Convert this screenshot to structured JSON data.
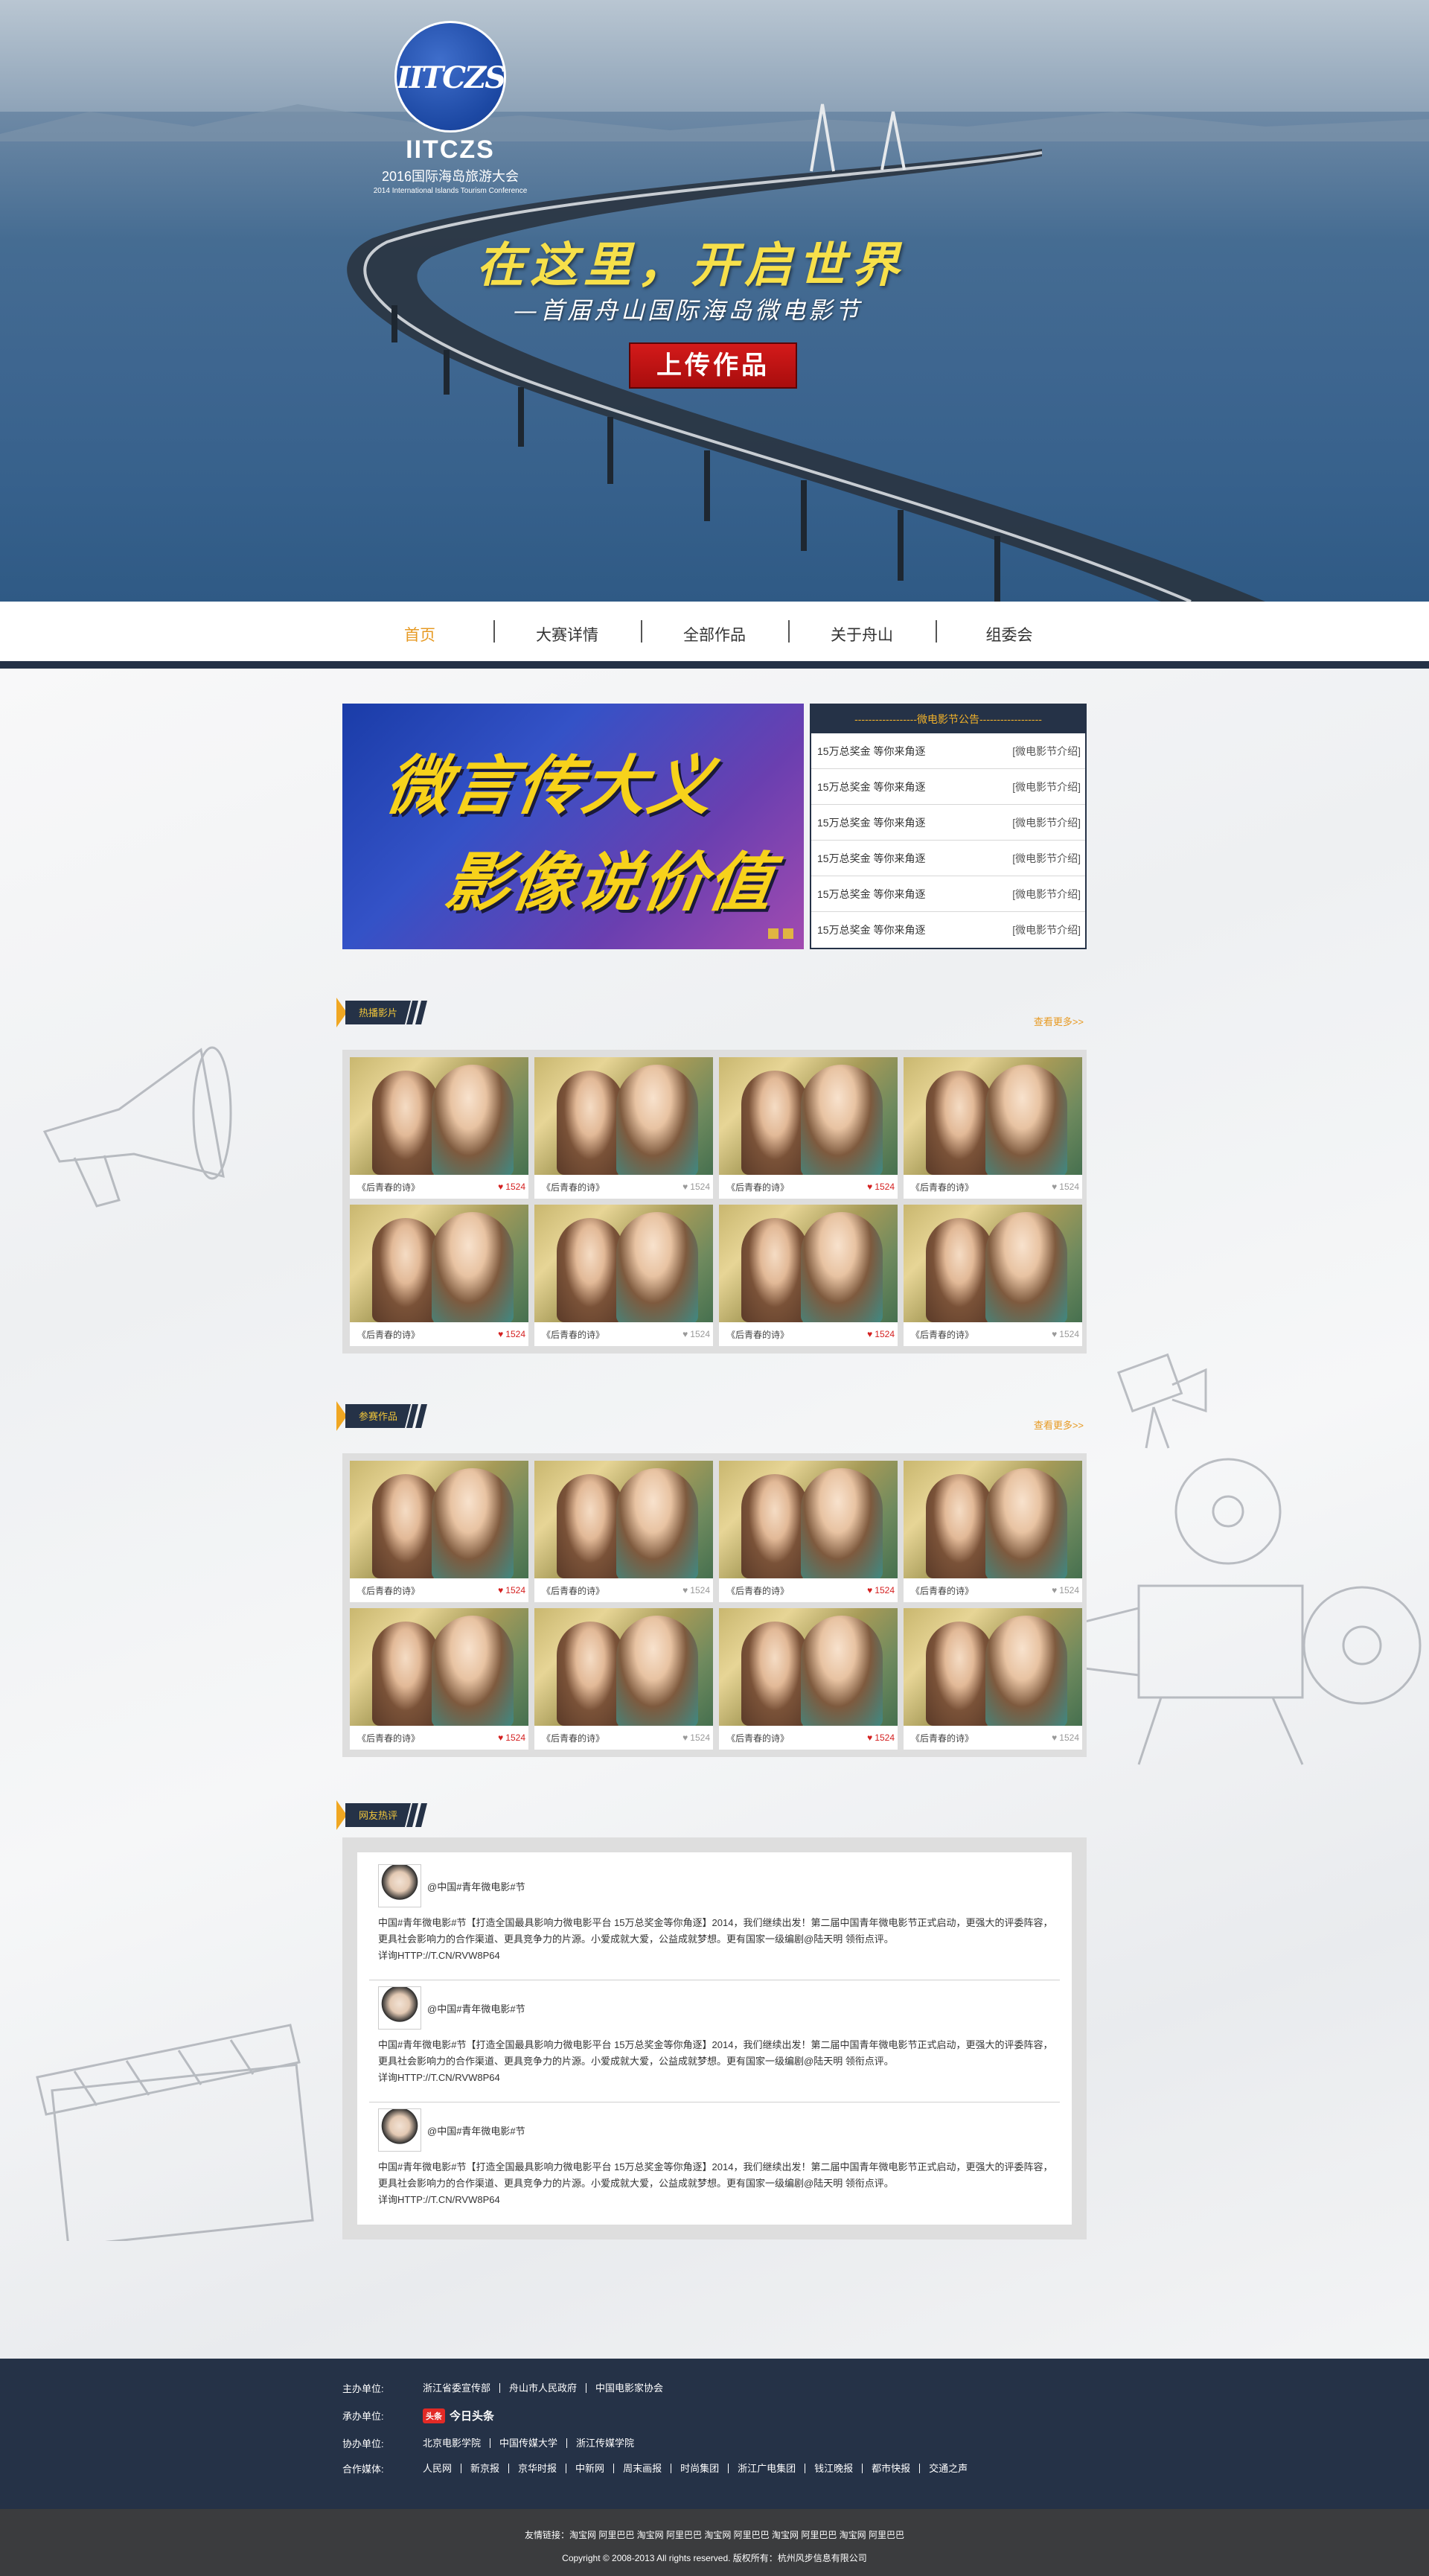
{
  "hero": {
    "logo_letters": "IITCZS",
    "brand": "IITCZS",
    "conference_cn": "2016国际海岛旅游大会",
    "conference_en": "2014 International Islands Tourism Conference",
    "slogan": "在这里，开启世界",
    "subslogan": "—首届舟山国际海岛微电影节",
    "upload_button": "上传作品"
  },
  "nav": {
    "items": [
      {
        "label": "首页",
        "active": true
      },
      {
        "label": "大赛详情",
        "active": false
      },
      {
        "label": "全部作品",
        "active": false
      },
      {
        "label": "关于舟山",
        "active": false
      },
      {
        "label": "组委会",
        "active": false
      }
    ]
  },
  "banner": {
    "line1": "微言传大义",
    "line2": "影像说价值"
  },
  "notice": {
    "title": "------------------微电影节公告------------------",
    "items": [
      {
        "text": "15万总奖金 等你来角逐",
        "tag": "[微电影节介绍]"
      },
      {
        "text": "15万总奖金 等你来角逐",
        "tag": "[微电影节介绍]"
      },
      {
        "text": "15万总奖金 等你来角逐",
        "tag": "[微电影节介绍]"
      },
      {
        "text": "15万总奖金 等你来角逐",
        "tag": "[微电影节介绍]"
      },
      {
        "text": "15万总奖金 等你来角逐",
        "tag": "[微电影节介绍]"
      },
      {
        "text": "15万总奖金 等你来角逐",
        "tag": "[微电影节介绍]"
      }
    ]
  },
  "sections": {
    "hot": {
      "label": "热播影片",
      "more": "查看更多>>"
    },
    "entries": {
      "label": "参赛作品",
      "more": "查看更多>>"
    },
    "comments": {
      "label": "网友热评"
    }
  },
  "hot_cards": [
    {
      "title": "《后青春的诗》",
      "likes": "1524",
      "liked": true
    },
    {
      "title": "《后青春的诗》",
      "likes": "1524",
      "liked": false
    },
    {
      "title": "《后青春的诗》",
      "likes": "1524",
      "liked": true
    },
    {
      "title": "《后青春的诗》",
      "likes": "1524",
      "liked": false
    },
    {
      "title": "《后青春的诗》",
      "likes": "1524",
      "liked": true
    },
    {
      "title": "《后青春的诗》",
      "likes": "1524",
      "liked": false
    },
    {
      "title": "《后青春的诗》",
      "likes": "1524",
      "liked": true
    },
    {
      "title": "《后青春的诗》",
      "likes": "1524",
      "liked": false
    }
  ],
  "entry_cards": [
    {
      "title": "《后青春的诗》",
      "likes": "1524",
      "liked": true
    },
    {
      "title": "《后青春的诗》",
      "likes": "1524",
      "liked": false
    },
    {
      "title": "《后青春的诗》",
      "likes": "1524",
      "liked": true
    },
    {
      "title": "《后青春的诗》",
      "likes": "1524",
      "liked": false
    },
    {
      "title": "《后青春的诗》",
      "likes": "1524",
      "liked": true
    },
    {
      "title": "《后青春的诗》",
      "likes": "1524",
      "liked": false
    },
    {
      "title": "《后青春的诗》",
      "likes": "1524",
      "liked": true
    },
    {
      "title": "《后青春的诗》",
      "likes": "1524",
      "liked": false
    }
  ],
  "comments": [
    {
      "user": "@中国#青年微电影#节",
      "text": "中国#青年微电影#节【打造全国最具影响力微电影平台 15万总奖金等你角逐】2014，我们继续出发！第二届中国青年微电影节正式启动，更强大的评委阵容，更具社会影响力的合作渠道、更具竞争力的片源。小爱成就大爱，公益成就梦想。更有国家一级编剧@陆天明 领衔点评。",
      "link": "详询HTTP://T.CN/RVW8P64"
    },
    {
      "user": "@中国#青年微电影#节",
      "text": "中国#青年微电影#节【打造全国最具影响力微电影平台 15万总奖金等你角逐】2014，我们继续出发！第二届中国青年微电影节正式启动，更强大的评委阵容，更具社会影响力的合作渠道、更具竞争力的片源。小爱成就大爱，公益成就梦想。更有国家一级编剧@陆天明 领衔点评。",
      "link": "详询HTTP://T.CN/RVW8P64"
    },
    {
      "user": "@中国#青年微电影#节",
      "text": "中国#青年微电影#节【打造全国最具影响力微电影平台 15万总奖金等你角逐】2014，我们继续出发！第二届中国青年微电影节正式启动，更强大的评委阵容，更具社会影响力的合作渠道、更具竞争力的片源。小爱成就大爱，公益成就梦想。更有国家一级编剧@陆天明 领衔点评。",
      "link": "详询HTTP://T.CN/RVW8P64"
    }
  ],
  "footer": {
    "host_label": "主办单位:",
    "hosts": [
      "浙江省委宣传部",
      "舟山市人民政府",
      "中国电影家协会"
    ],
    "organizer_label": "承办单位:",
    "organizer_badge": "头条",
    "organizer_name": "今日头条",
    "co_label": "协办单位:",
    "co": [
      "北京电影学院",
      "中国传媒大学",
      "浙江传媒学院"
    ],
    "media_label": "合作媒体:",
    "media": [
      "人民网",
      "新京报",
      "京华时报",
      "中新网",
      "周末画报",
      "时尚集团",
      "浙江广电集团",
      "钱江晚报",
      "都市快报",
      "交通之声"
    ],
    "friend_links": "友情链接：淘宝网 阿里巴巴 淘宝网 阿里巴巴 淘宝网 阿里巴巴 淘宝网 阿里巴巴 淘宝网 阿里巴巴",
    "copyright": "Copyright © 2008-2013 All rights reserved. 版权所有：杭州风步信息有限公司"
  }
}
